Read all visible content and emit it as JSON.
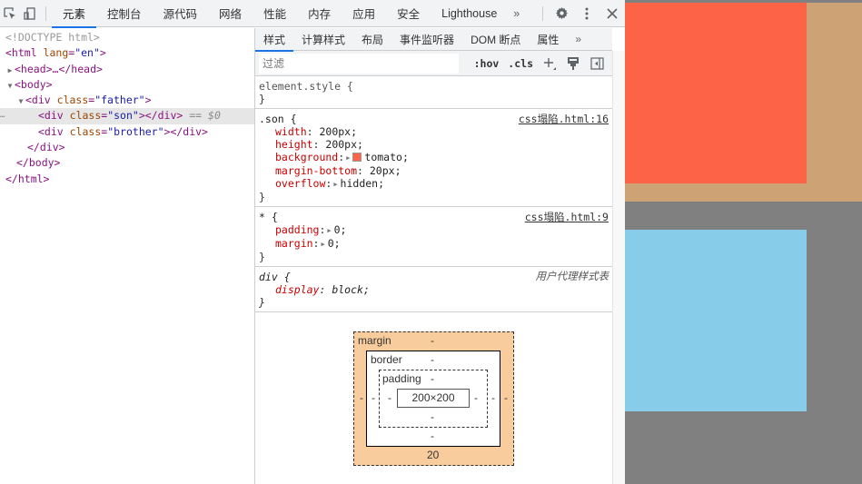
{
  "toolbar": {
    "tabs": [
      "元素",
      "控制台",
      "源代码",
      "网络",
      "性能",
      "内存",
      "应用",
      "安全",
      "Lighthouse"
    ],
    "active_tab": "元素",
    "more": "»",
    "icons": [
      "inspect-element-icon",
      "device-toolbar-icon",
      "gear-icon",
      "more-vert-icon",
      "close-icon"
    ]
  },
  "elements_tree": {
    "doctype": "<!DOCTYPE html>",
    "html_open": "<html",
    "html_attr": "lang",
    "html_attr_val": "\"en\"",
    "head": "<head>…</head>",
    "body_open": "<body>",
    "div_open": "<div",
    "class_attr": "class",
    "father_val": "\"father\"",
    "son_val": "\"son\"",
    "brother_val": "\"brother\"",
    "close_bracket": ">",
    "div_close": "></div>",
    "div_end": "</div>",
    "body_close": "</body>",
    "html_close": "</html>",
    "eq": "==",
    "selected_ref": "$0",
    "dots": "…"
  },
  "styles_pane": {
    "tabs": [
      "样式",
      "计算样式",
      "布局",
      "事件监听器",
      "DOM 断点",
      "属性"
    ],
    "active_tab": "样式",
    "more": "»",
    "filter_placeholder": "过滤",
    "hov": ":hov",
    "cls": ".cls",
    "rules": [
      {
        "selector": "element.style {",
        "source": "",
        "props": []
      },
      {
        "selector": ".son {",
        "source": "css塌陷.html:16",
        "props": [
          {
            "name": "width",
            "value": "200px;"
          },
          {
            "name": "height",
            "value": "200px;"
          },
          {
            "name": "background",
            "value": "tomato;",
            "swatch": "#ff6347"
          },
          {
            "name": "margin-bottom",
            "value": "20px;"
          },
          {
            "name": "overflow",
            "value": "hidden;"
          }
        ]
      },
      {
        "selector": "* {",
        "source": "css塌陷.html:9",
        "props": [
          {
            "name": "padding",
            "value": "0;"
          },
          {
            "name": "margin",
            "value": "0;"
          }
        ]
      },
      {
        "selector": "div {",
        "source": "用户代理样式表",
        "props": [
          {
            "name": "display",
            "value": "block;"
          }
        ]
      }
    ],
    "close_brace": "}",
    "colon": ":"
  },
  "box_model": {
    "margin_label": "margin",
    "border_label": "border",
    "padding_label": "padding",
    "content": "200×200",
    "margin": {
      "top": "-",
      "right": "-",
      "bottom": "20",
      "left": "-"
    },
    "border": {
      "top": "-",
      "right": "-",
      "bottom": "-",
      "left": "-"
    },
    "padding": {
      "top": "-",
      "right": "-",
      "bottom": "-",
      "left": "-"
    }
  },
  "page_preview": {
    "father_color": "#cda274",
    "son_color": "#fd6347",
    "brother_color": "#87cce8",
    "body_color": "#808080"
  }
}
